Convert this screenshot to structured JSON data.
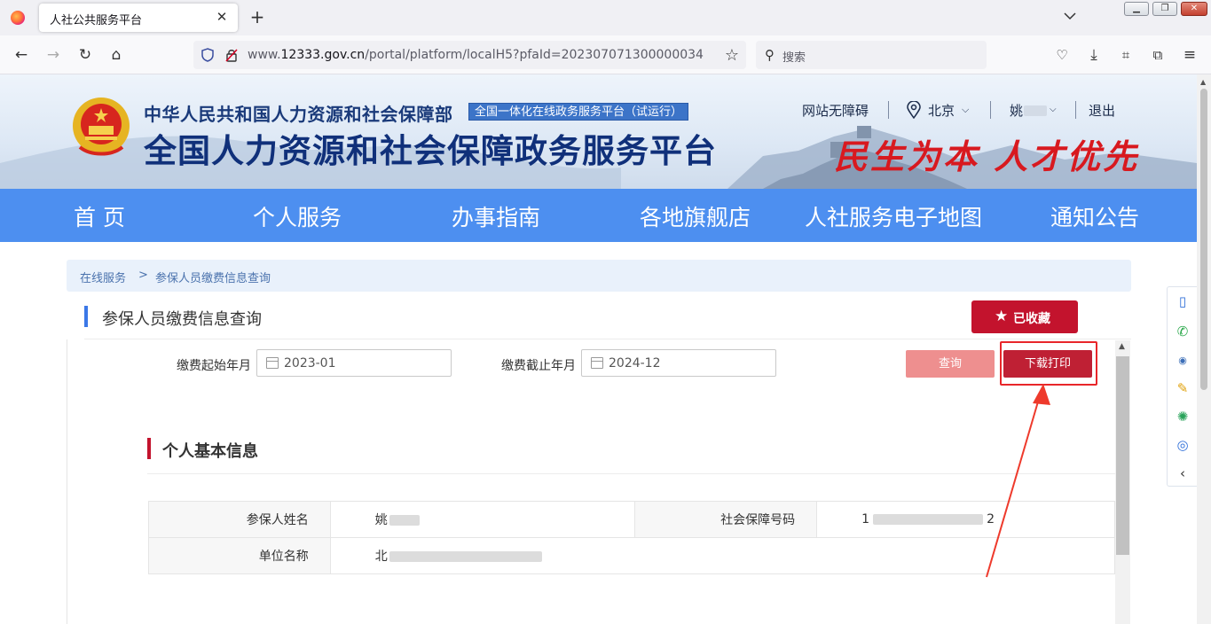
{
  "browser": {
    "tab_title": "人社公共服务平台",
    "url_prefix": "www.",
    "url_domain": "12333.gov.cn",
    "url_path": "/portal/platform/localH5?pfaId=202307071300000034",
    "search_placeholder": "搜索"
  },
  "header": {
    "ministry": "中华人民共和国人力资源和社会保障部",
    "badge": "全国一体化在线政务服务平台（试运行）",
    "platform_title": "全国人力资源和社会保障政务服务平台",
    "slogan": "民生为本  人才优先",
    "accessibility": "网站无障碍",
    "city": "北京",
    "user": "姚",
    "logout": "退出"
  },
  "nav": {
    "items": [
      "首 页",
      "个人服务",
      "办事指南",
      "各地旗舰店",
      "人社服务电子地图",
      "通知公告"
    ]
  },
  "breadcrumb": {
    "root": "在线服务",
    "sep": ">",
    "current": "参保人员缴费信息查询"
  },
  "page": {
    "title": "参保人员缴费信息查询",
    "favorite_label": "已收藏"
  },
  "form": {
    "start_label": "缴费起始年月",
    "start_value": "2023-01",
    "end_label": "缴费截止年月",
    "end_value": "2024-12",
    "query_label": "查询",
    "print_label": "下载打印"
  },
  "info": {
    "section_title": "个人基本信息",
    "rows": [
      {
        "label1": "参保人姓名",
        "value1": "姚",
        "label2": "社会保障号码",
        "value2_start": "1",
        "value2_end": "2"
      },
      {
        "label1": "单位名称",
        "value1": "北"
      }
    ]
  },
  "colors": {
    "nav_blue": "#4d8ff0",
    "brand_red": "#c3132d",
    "highlight_red": "#e8262a"
  }
}
